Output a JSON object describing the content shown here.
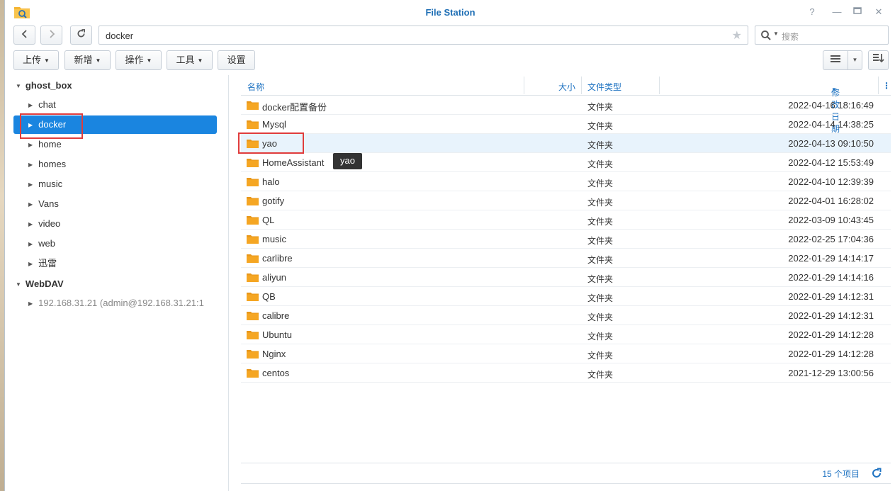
{
  "window": {
    "title": "File Station"
  },
  "nav": {
    "path": "docker"
  },
  "search": {
    "placeholder": "搜索"
  },
  "toolbar": {
    "upload": "上传",
    "create": "新增",
    "action": "操作",
    "tools": "工具",
    "settings": "设置"
  },
  "sidebar": {
    "root": "ghost_box",
    "items": [
      "chat",
      "docker",
      "home",
      "homes",
      "music",
      "Vans",
      "video",
      "web",
      "迅雷"
    ],
    "selected": "docker",
    "webdav_root": "WebDAV",
    "webdav_items": [
      "192.168.31.21 (admin@192.168.31.21:1"
    ]
  },
  "columns": {
    "name": "名称",
    "size": "大小",
    "type": "文件类型",
    "modified": "修改日期"
  },
  "files": [
    {
      "name": "docker配置备份",
      "type": "文件夹",
      "date": "2022-04-16 18:16:49"
    },
    {
      "name": "Mysql",
      "type": "文件夹",
      "date": "2022-04-14 14:38:25"
    },
    {
      "name": "yao",
      "type": "文件夹",
      "date": "2022-04-13 09:10:50"
    },
    {
      "name": "HomeAssistant",
      "type": "文件夹",
      "date": "2022-04-12 15:53:49"
    },
    {
      "name": "halo",
      "type": "文件夹",
      "date": "2022-04-10 12:39:39"
    },
    {
      "name": "gotify",
      "type": "文件夹",
      "date": "2022-04-01 16:28:02"
    },
    {
      "name": "QL",
      "type": "文件夹",
      "date": "2022-03-09 10:43:45"
    },
    {
      "name": "music",
      "type": "文件夹",
      "date": "2022-02-25 17:04:36"
    },
    {
      "name": "carlibre",
      "type": "文件夹",
      "date": "2022-01-29 14:14:17"
    },
    {
      "name": "aliyun",
      "type": "文件夹",
      "date": "2022-01-29 14:14:16"
    },
    {
      "name": "QB",
      "type": "文件夹",
      "date": "2022-01-29 14:12:31"
    },
    {
      "name": "calibre",
      "type": "文件夹",
      "date": "2022-01-29 14:12:31"
    },
    {
      "name": "Ubuntu",
      "type": "文件夹",
      "date": "2022-01-29 14:12:28"
    },
    {
      "name": "Nginx",
      "type": "文件夹",
      "date": "2022-01-29 14:12:28"
    },
    {
      "name": "centos",
      "type": "文件夹",
      "date": "2021-12-29 13:00:56"
    }
  ],
  "tooltip": "yao",
  "footer": {
    "count": "15 个项目"
  },
  "colors": {
    "accent": "#1a85e0",
    "link": "#1f73c2",
    "folder": "#f5a623",
    "highlight": "#e03c3c"
  }
}
